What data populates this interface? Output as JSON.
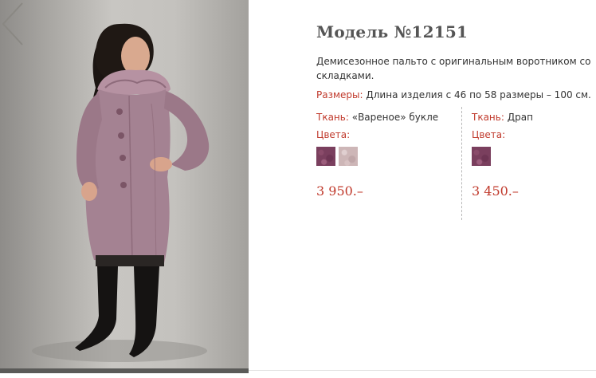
{
  "product": {
    "title": "Модель №12151",
    "description": "Демисезонное пальто с оригинальным воротником со складками.",
    "sizes_label": "Размеры:",
    "sizes_text": "Длина изделия с 46 по 58 размеры – 100 см."
  },
  "variants": [
    {
      "fabric_label": "Ткань:",
      "fabric_value": "«Вареное» букле",
      "colors_label": "Цвета:",
      "swatches": [
        "plum-melange",
        "pale-pink-melange"
      ],
      "price": "3 950.–"
    },
    {
      "fabric_label": "Ткань:",
      "fabric_value": "Драп",
      "colors_label": "Цвета:",
      "swatches": [
        "plum-melange"
      ],
      "price": "3 450.–"
    }
  ],
  "colors": {
    "accent": "#c0392b",
    "title": "#555555",
    "coat": "#a48292"
  }
}
